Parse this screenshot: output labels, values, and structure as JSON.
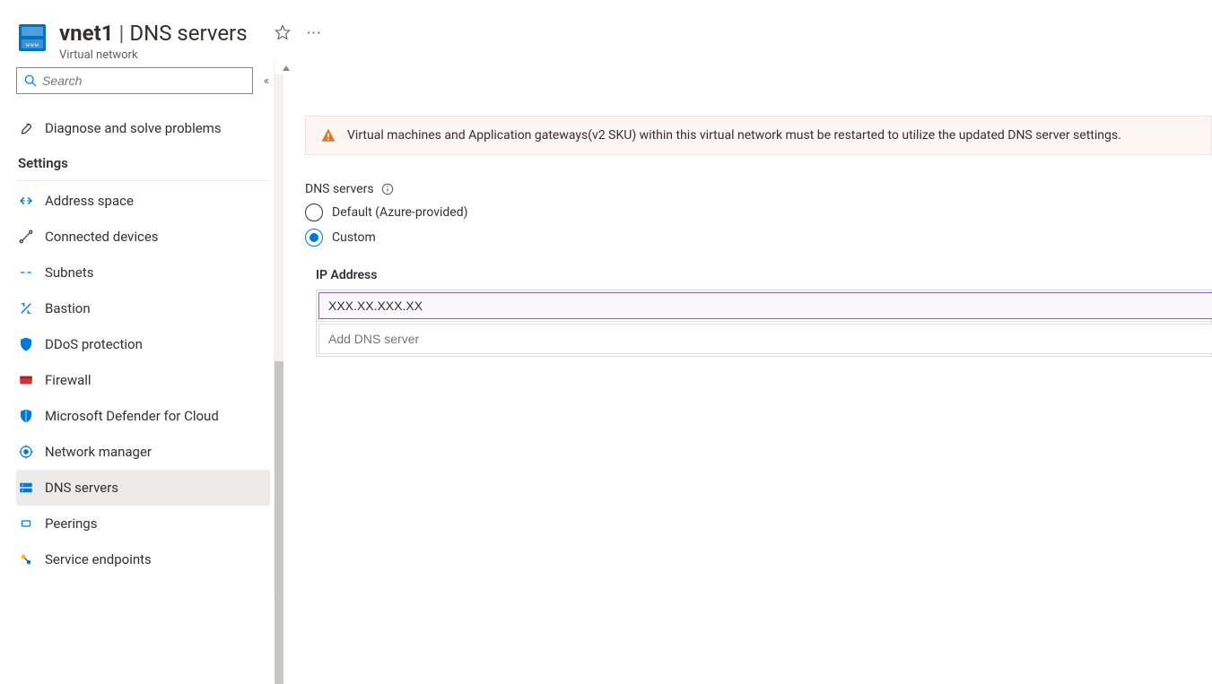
{
  "header": {
    "resource_name": "vnet1",
    "page_title": "DNS servers",
    "resource_type": "Virtual network"
  },
  "sidebar": {
    "search_placeholder": "Search",
    "top_items": [
      {
        "label": "Diagnose and solve problems"
      }
    ],
    "section_label": "Settings",
    "items": [
      {
        "label": "Address space"
      },
      {
        "label": "Connected devices"
      },
      {
        "label": "Subnets"
      },
      {
        "label": "Bastion"
      },
      {
        "label": "DDoS protection"
      },
      {
        "label": "Firewall"
      },
      {
        "label": "Microsoft Defender for Cloud"
      },
      {
        "label": "Network manager"
      },
      {
        "label": "DNS servers"
      },
      {
        "label": "Peerings"
      },
      {
        "label": "Service endpoints"
      }
    ]
  },
  "banner": {
    "message": "Virtual machines and Application gateways(v2 SKU) within this virtual network must be restarted to utilize the updated DNS server settings."
  },
  "dns": {
    "section_label": "DNS servers",
    "options": {
      "default": "Default (Azure-provided)",
      "custom": "Custom"
    },
    "selected": "custom",
    "ip_column_label": "IP Address",
    "ip_value": "XXX.XX.XXX.XX",
    "add_placeholder": "Add DNS server"
  }
}
